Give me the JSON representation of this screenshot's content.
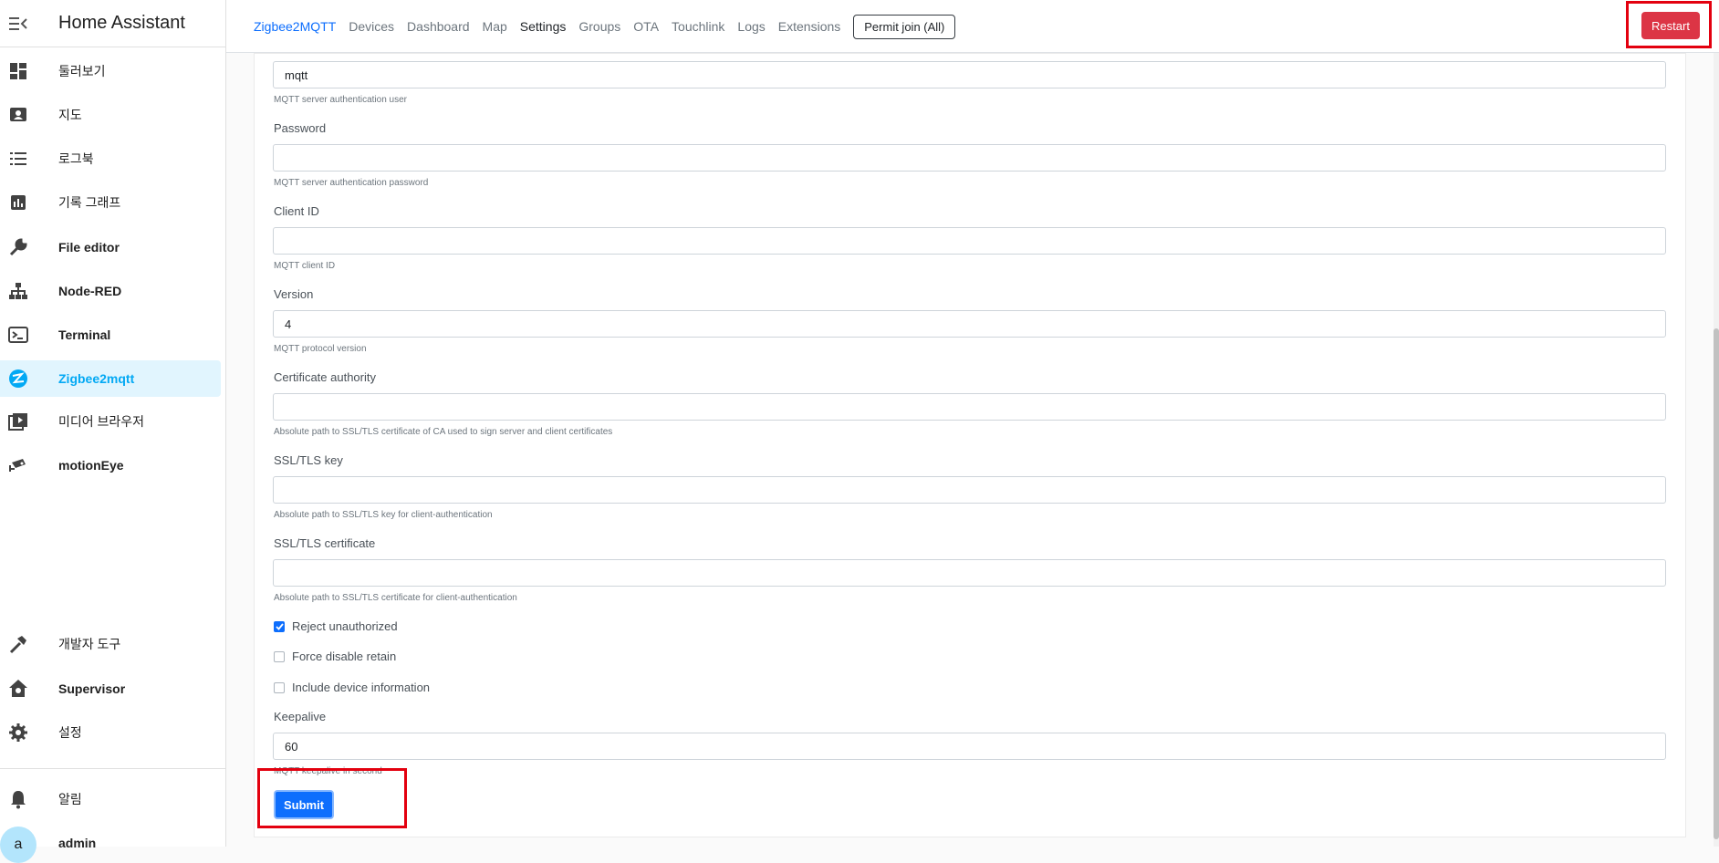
{
  "sidebar": {
    "title": "Home Assistant",
    "items": [
      {
        "label": "둘러보기",
        "icon": "dashboard-icon"
      },
      {
        "label": "지도",
        "icon": "map-icon"
      },
      {
        "label": "로그북",
        "icon": "logbook-icon"
      },
      {
        "label": "기록 그래프",
        "icon": "history-chart-icon"
      },
      {
        "label": "File editor",
        "icon": "wrench-icon"
      },
      {
        "label": "Node-RED",
        "icon": "sitemap-icon"
      },
      {
        "label": "Terminal",
        "icon": "console-icon"
      },
      {
        "label": "Zigbee2mqtt",
        "icon": "zigbee-icon"
      },
      {
        "label": "미디어 브라우저",
        "icon": "media-icon"
      },
      {
        "label": "motionEye",
        "icon": "camera-icon"
      }
    ],
    "bottom_items": [
      {
        "label": "개발자 도구",
        "icon": "hammer-icon"
      },
      {
        "label": "Supervisor",
        "icon": "home-assistant-icon"
      },
      {
        "label": "설정",
        "icon": "gear-icon"
      }
    ],
    "notifications_label": "알림",
    "user_initial": "a",
    "user_name": "admin"
  },
  "topnav": {
    "brand": "Zigbee2MQTT",
    "links": [
      "Devices",
      "Dashboard",
      "Map",
      "Settings",
      "Groups",
      "OTA",
      "Touchlink",
      "Logs",
      "Extensions"
    ],
    "active": "Settings",
    "permit_join": "Permit join (All)",
    "restart": "Restart"
  },
  "form": {
    "user_value": "mqtt",
    "user_help": "MQTT server authentication user",
    "password_label": "Password",
    "password_help": "MQTT server authentication password",
    "client_id_label": "Client ID",
    "client_id_help": "MQTT client ID",
    "version_label": "Version",
    "version_value": "4",
    "version_help": "MQTT protocol version",
    "ca_label": "Certificate authority",
    "ca_help": "Absolute path to SSL/TLS certificate of CA used to sign server and client certificates",
    "key_label": "SSL/TLS key",
    "key_help": "Absolute path to SSL/TLS key for client-authentication",
    "cert_label": "SSL/TLS certificate",
    "cert_help": "Absolute path to SSL/TLS certificate for client-authentication",
    "reject_unauthorized": "Reject unauthorized",
    "reject_unauthorized_checked": true,
    "force_disable_retain": "Force disable retain",
    "force_disable_retain_checked": false,
    "include_device_info": "Include device information",
    "include_device_info_checked": false,
    "keepalive_label": "Keepalive",
    "keepalive_value": "60",
    "keepalive_help": "MQTT keepalive in second",
    "submit": "Submit"
  }
}
